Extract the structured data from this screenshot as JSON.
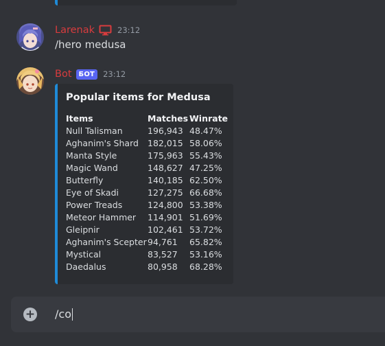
{
  "messages": [
    {
      "username": "Larenak",
      "timestamp": "23:12",
      "content": "/hero medusa",
      "username_color": "#d83c3e",
      "icons": [
        "monitor-icon"
      ]
    },
    {
      "username": "Bot",
      "badge": "БОТ",
      "timestamp": "23:12",
      "username_color": "#d83c3e",
      "embed": {
        "title": "Popular items for Medusa",
        "accent_color": "#1f8bd8",
        "columns": [
          "Items",
          "Matches",
          "Winrate"
        ],
        "rows": [
          [
            "Null Talisman",
            "196,943",
            "48.47%"
          ],
          [
            "Aghanim's Shard",
            "182,015",
            "58.06%"
          ],
          [
            "Manta Style",
            "175,963",
            "55.43%"
          ],
          [
            "Magic Wand",
            "148,627",
            "47.25%"
          ],
          [
            "Butterfly",
            "140,185",
            "62.50%"
          ],
          [
            "Eye of Skadi",
            "127,275",
            "66.68%"
          ],
          [
            "Power Treads",
            "124,800",
            "53.38%"
          ],
          [
            "Meteor Hammer",
            "114,901",
            "51.69%"
          ],
          [
            "Gleipnir",
            "102,461",
            "53.72%"
          ],
          [
            "Aghanim's Scepter",
            "94,761",
            "65.82%"
          ],
          [
            "Mystical",
            "83,527",
            "53.16%"
          ],
          [
            "Daedalus",
            "80,958",
            "68.28%"
          ]
        ]
      }
    }
  ],
  "composer": {
    "value": "/co",
    "add_icon": "plus-circle-icon"
  },
  "colors": {
    "background": "#313338",
    "embed_background": "#2b2d31",
    "badge": "#5865f2",
    "input_background": "#383a40"
  }
}
